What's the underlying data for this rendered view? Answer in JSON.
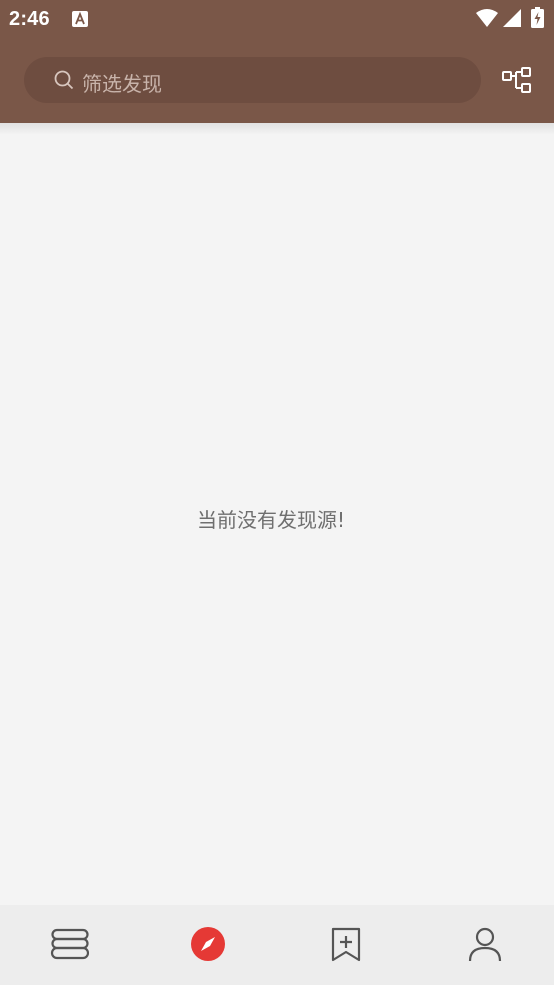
{
  "status_bar": {
    "time": "2:46",
    "icons": [
      "notification-a-icon",
      "wifi-icon",
      "signal-icon",
      "battery-charging-icon"
    ]
  },
  "header": {
    "search": {
      "placeholder": "筛选发现"
    },
    "config_icon": "group-config-icon"
  },
  "main": {
    "empty_message": "当前没有发现源!"
  },
  "bottom_nav": {
    "items": [
      {
        "name": "bookshelf",
        "icon": "bookshelf-icon",
        "active": false
      },
      {
        "name": "explore",
        "icon": "compass-icon",
        "active": true
      },
      {
        "name": "rss",
        "icon": "bookmark-add-icon",
        "active": false
      },
      {
        "name": "my",
        "icon": "person-icon",
        "active": false
      }
    ]
  },
  "colors": {
    "header_bg": "#7a5748",
    "search_bg": "#6e4d40",
    "accent": "#e53935",
    "page_bg": "#f4f4f4",
    "nav_bg": "#ededed",
    "nav_icon": "#555555"
  }
}
